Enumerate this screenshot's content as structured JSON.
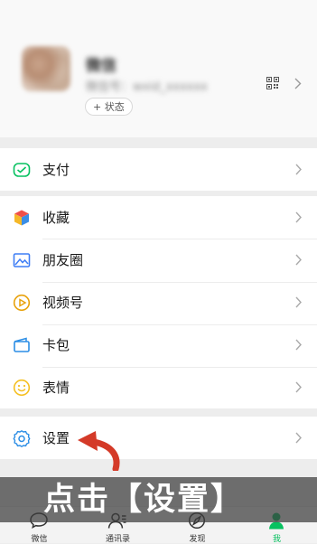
{
  "profile": {
    "name_blurred": "微信",
    "id_blurred": "微信号：wxid_xxxxxx",
    "status_label": "+ 状态"
  },
  "menu": {
    "pay": "支付",
    "favorites": "收藏",
    "moments": "朋友圈",
    "channels": "视频号",
    "cards": "卡包",
    "stickers": "表情",
    "settings": "设置"
  },
  "overlay": {
    "caption": "点击【设置】"
  },
  "tabbar": {
    "tabs": [
      {
        "label": "微信",
        "icon": "chat-icon"
      },
      {
        "label": "通讯录",
        "icon": "contacts-icon"
      },
      {
        "label": "发现",
        "icon": "compass-icon"
      },
      {
        "label": "我",
        "icon": "me-icon"
      }
    ],
    "active": "我"
  },
  "colors": {
    "accent": "#07c160",
    "pay_icon": "#07c160",
    "moments_icon": "#3f7ef5",
    "channels_icon": "#e8a20c",
    "cards_icon": "#2b8de5",
    "stickers_icon": "#f5c022",
    "settings_icon": "#2b8de5",
    "arrow": "#d43a28"
  }
}
